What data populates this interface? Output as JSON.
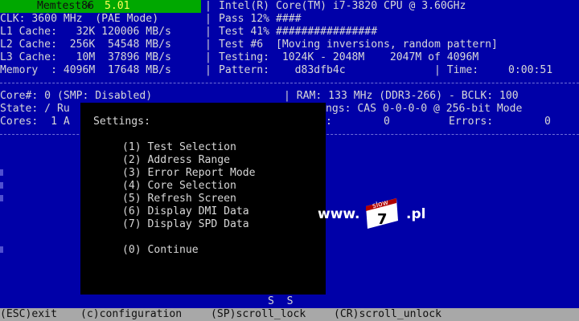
{
  "header": {
    "app_name": "Memtest86",
    "plus": "+",
    "version": "5.01",
    "cpu": "Intel(R) Core(TM) i7-3820 CPU @ 3.60GHz"
  },
  "left_info": {
    "clk": "CLK: 3600 MHz  (PAE Mode)",
    "l1": "L1 Cache:   32K 120006 MB/s",
    "l2": "L2 Cache:  256K  54548 MB/s",
    "l3": "L3 Cache:   10M  37896 MB/s",
    "mem": "Memory  : 4096M  17648 MB/s"
  },
  "right_info": {
    "pass": "Pass 12% ####",
    "test_pct": "Test 41% ################",
    "test_num": "Test #6  [Moving inversions, random pattern]",
    "testing": "Testing:  1024K - 2048M    2047M of 4096M",
    "pattern": "Pattern:    d83dfb4c",
    "time_label": "| Time:",
    "time_value": "0:00:51"
  },
  "core_info": {
    "core": "Core#: 0 (SMP: Disabled)",
    "ram": "| RAM: 133 MHz (DDR3-266) - BCLK: 100",
    "state": "State: / Ru",
    "timings": "ngs: CAS 0-0-0-0 @ 256-bit Mode",
    "cores": "Cores:  1 A",
    "errors_prefix": ":",
    "errors_zero1": "0",
    "errors_label": "Errors:",
    "errors_value": "0"
  },
  "settings": {
    "title": "Settings:",
    "items": [
      "(1) Test Selection",
      "(2) Address Range",
      "(3) Error Report Mode",
      "(4) Core Selection",
      "(5) Refresh Screen",
      "(6) Display DMI Data",
      "(7) Display SPD Data"
    ],
    "continue": "(0) Continue"
  },
  "ss_marks": "S  S",
  "statusbar": {
    "esc": "(ESC)exit",
    "config": "(c)configuration",
    "sp": "(SP)scroll_lock",
    "cr": "(CR)scroll_unlock"
  },
  "watermark": {
    "prefix": "www.",
    "badge_top": "slow",
    "badge_num": "7",
    "suffix": ".pl"
  },
  "colors": {
    "background": "#0000a8",
    "title_green": "#00a800",
    "version_yellow": "#ffff55",
    "popup_black": "#000000",
    "status_gray": "#a8a8a8"
  }
}
